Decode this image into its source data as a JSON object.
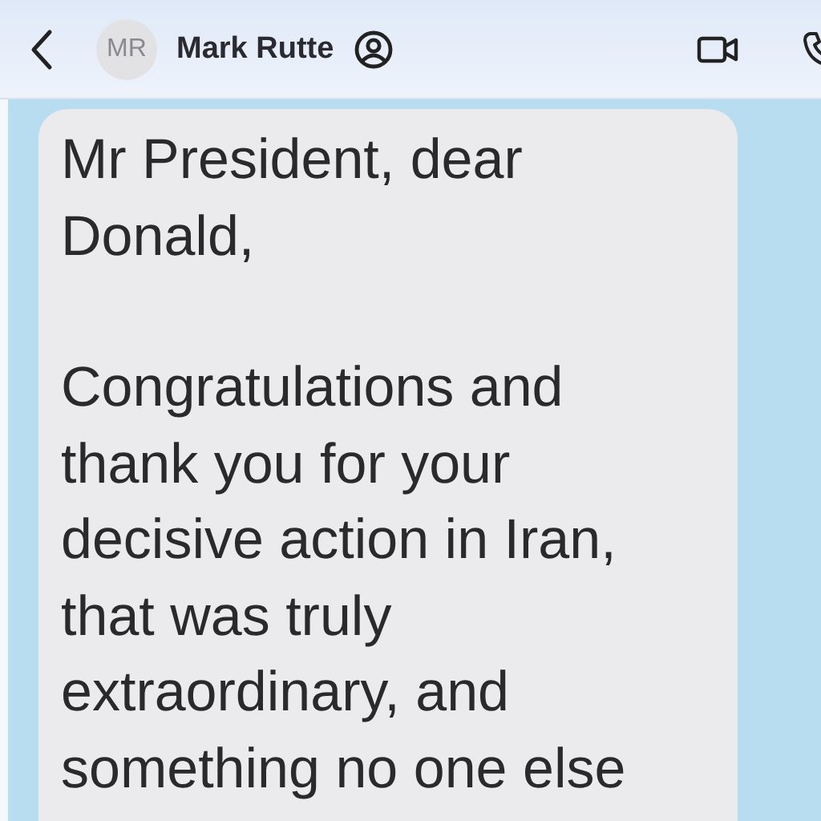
{
  "header": {
    "avatar_initials": "MR",
    "contact_name": "Mark Rutte"
  },
  "message": {
    "paragraphs": [
      "Mr President, dear\nDonald,",
      "Congratulations and\nthank you for your\ndecisive action in Iran,\nthat was truly\nextraordinary, and\nsomething no one else"
    ]
  }
}
